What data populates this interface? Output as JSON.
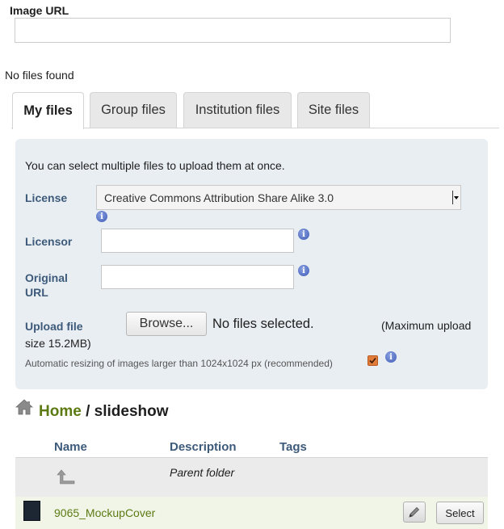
{
  "image_url": {
    "label": "Image URL",
    "value": "",
    "placeholder": ""
  },
  "status": {
    "no_files": "No files found"
  },
  "tabs": [
    {
      "label": "My files",
      "active": true
    },
    {
      "label": "Group files",
      "active": false
    },
    {
      "label": "Institution files",
      "active": false
    },
    {
      "label": "Site files",
      "active": false
    }
  ],
  "upload": {
    "intro": "You can select multiple files to upload them at once.",
    "license_label": "License",
    "license_value": "Creative Commons Attribution Share Alike 3.0",
    "licensor_label": "Licensor",
    "licensor_value": "",
    "original_url_label_line1": "Original",
    "original_url_label_line2": "URL",
    "original_url_value": "",
    "upload_file_label": "Upload file",
    "browse_label": "Browse...",
    "no_file_selected": "No files selected.",
    "max_upload": "(Maximum upload",
    "max_size": "size 15.2MB)",
    "resize_text": "Automatic resizing of images larger than 1024x1024 px (recommended)",
    "resize_checked": true,
    "info_glyph": "i"
  },
  "breadcrumb": {
    "home": "Home",
    "separator": "/",
    "current": "slideshow"
  },
  "table": {
    "columns": [
      "Name",
      "Description",
      "Tags"
    ],
    "parent_label": "Parent folder",
    "files": [
      {
        "name": "9065_MockupCover",
        "edit_icon": "pencil-icon",
        "select_label": "Select"
      }
    ]
  },
  "colors": {
    "link_green": "#5c7a12",
    "label_blue": "#3d5a7a",
    "panel_bg": "#e9eef3",
    "checkbox_orange": "#e07b39",
    "info_blue": "#3e5bb8"
  }
}
